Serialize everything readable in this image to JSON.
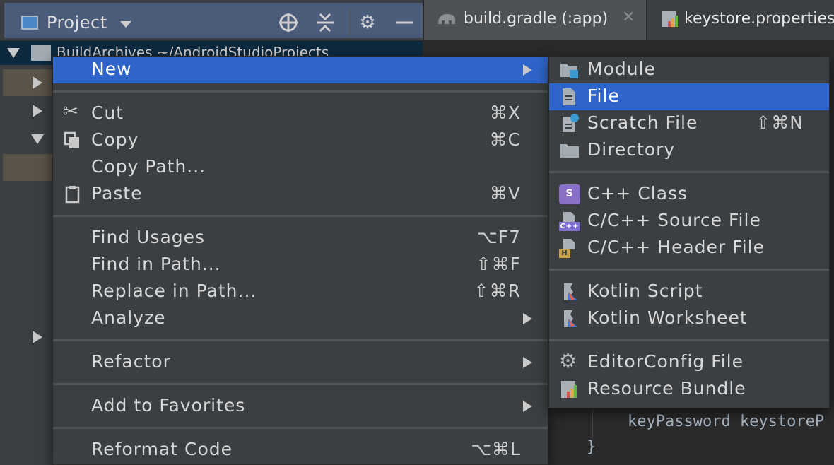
{
  "project_panel": {
    "title": "Project",
    "tree_root_label": "BuildArchives ~/AndroidStudioProjects"
  },
  "tabs": [
    {
      "label": "build.gradle (:app)",
      "active": true
    },
    {
      "label": "keystore.properties",
      "active": false
    }
  ],
  "editor": {
    "code_lines": [
      "keyPassword keystoreP",
      "}"
    ]
  },
  "main_menu": {
    "new": "New",
    "cut": "Cut",
    "cut_sc": "⌘X",
    "copy": "Copy",
    "copy_sc": "⌘C",
    "copy_path": "Copy Path...",
    "paste": "Paste",
    "paste_sc": "⌘V",
    "find_usages": "Find Usages",
    "find_usages_sc": "⌥F7",
    "find_in_path": "Find in Path...",
    "find_in_path_sc": "⇧⌘F",
    "replace_in_path": "Replace in Path...",
    "replace_in_path_sc": "⇧⌘R",
    "analyze": "Analyze",
    "refactor": "Refactor",
    "add_to_favorites": "Add to Favorites",
    "reformat_code": "Reformat Code",
    "reformat_code_sc": "⌥⌘L"
  },
  "sub_menu": {
    "module": "Module",
    "file": "File",
    "scratch_file": "Scratch File",
    "scratch_file_sc": "⇧⌘N",
    "directory": "Directory",
    "cpp_class": "C++ Class",
    "cpp_source": "C/C++ Source File",
    "cpp_header": "C/C++ Header File",
    "kotlin_script": "Kotlin Script",
    "kotlin_worksheet": "Kotlin Worksheet",
    "editorconfig": "EditorConfig File",
    "resource_bundle": "Resource Bundle"
  },
  "colors": {
    "selection": "#2f65ca",
    "menu_bg": "#3c3f41",
    "editor_bg": "#2b2b2b"
  }
}
